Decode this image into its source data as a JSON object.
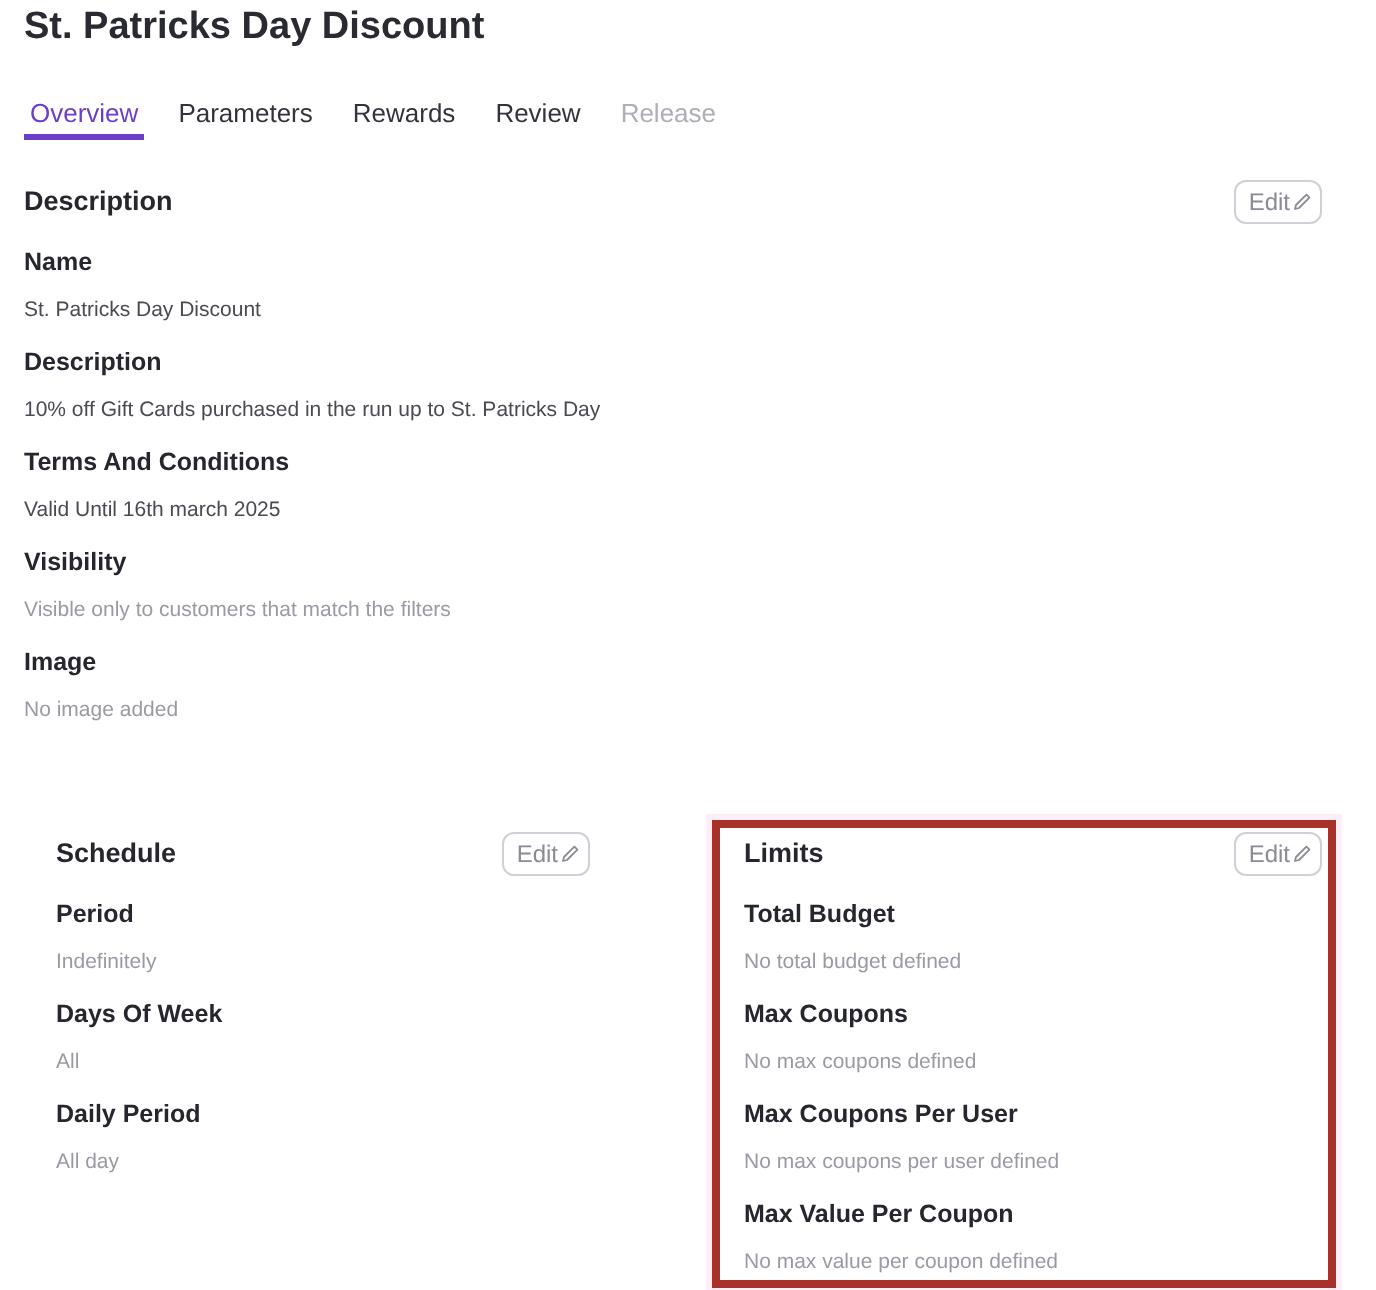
{
  "title": "St. Patricks Day Discount",
  "tabs": [
    {
      "label": "Overview",
      "selected": true,
      "disabled": false
    },
    {
      "label": "Parameters",
      "selected": false,
      "disabled": false
    },
    {
      "label": "Rewards",
      "selected": false,
      "disabled": false
    },
    {
      "label": "Review",
      "selected": false,
      "disabled": false
    },
    {
      "label": "Release",
      "selected": false,
      "disabled": true
    }
  ],
  "sections": [
    {
      "heading": "Description",
      "edit_button": "Edit",
      "highlighted": false,
      "fields": [
        {
          "label": "Name",
          "value": "St. Patricks Day Discount",
          "muted": false
        },
        {
          "label": "Description",
          "value": "10% off Gift Cards purchased in the run up to St. Patricks Day",
          "muted": false
        },
        {
          "label": "Terms And Conditions",
          "value": "Valid Until 16th march 2025",
          "muted": false
        },
        {
          "label": "Visibility",
          "value": "Visible only to customers that match the filters",
          "muted": true
        },
        {
          "label": "Image",
          "value": "No image added",
          "muted": true
        }
      ]
    },
    {
      "heading": "Schedule",
      "edit_button": "Edit",
      "highlighted": false,
      "fields": [
        {
          "label": "Period",
          "value": "Indefinitely",
          "muted": true
        },
        {
          "label": "Days Of Week",
          "value": "All",
          "muted": true
        },
        {
          "label": "Daily Period",
          "value": "All day",
          "muted": true
        }
      ]
    },
    {
      "heading": "Limits",
      "edit_button": "Edit",
      "highlighted": true,
      "fields": [
        {
          "label": "Total Budget",
          "value": "No total budget defined",
          "muted": true
        },
        {
          "label": "Max Coupons",
          "value": "No max coupons defined",
          "muted": true
        },
        {
          "label": "Max Coupons Per User",
          "value": "No max coupons per user defined",
          "muted": true
        },
        {
          "label": "Max Value Per Coupon",
          "value": "No max value per coupon defined",
          "muted": true
        }
      ]
    }
  ]
}
